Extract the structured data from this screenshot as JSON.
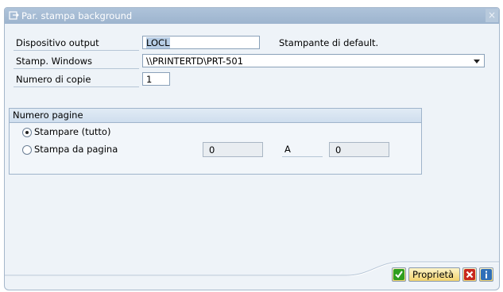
{
  "window": {
    "title": "Par. stampa background",
    "close_label": "×"
  },
  "fields": {
    "output_device": {
      "label": "Dispositivo output",
      "value": "LOCL",
      "note": "Stampante di default."
    },
    "windows_printer": {
      "label": "Stamp. Windows",
      "value": "\\\\PRINTERTD\\PRT-501"
    },
    "copies": {
      "label": "Numero di copie",
      "value": "1"
    }
  },
  "pages_group": {
    "title": "Numero pagine",
    "print_all": "Stampare (tutto)",
    "print_from": "Stampa da pagina",
    "from_value": "0",
    "to_label": "A",
    "to_value": "0",
    "selected": "print_all"
  },
  "buttons": {
    "properties": "Proprietà"
  },
  "colors": {
    "title_bar": "#9db4ce",
    "window_bg": "#eef3f8",
    "button_bg": "#f2d36e",
    "confirm": "#2f9e1f",
    "cancel": "#c8281e",
    "info": "#2f6fb8"
  },
  "icons": {
    "title": "print-dialog-icon",
    "confirm": "checkmark-icon",
    "cancel": "cancel-x-icon",
    "info": "info-icon"
  }
}
